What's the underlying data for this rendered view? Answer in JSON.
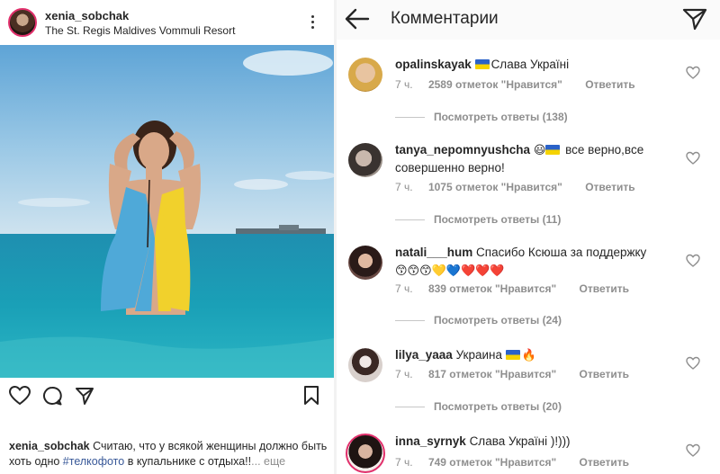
{
  "post": {
    "username": "xenia_sobchak",
    "location": "The St. Regis Maldives Vommuli Resort",
    "caption": {
      "username": "xenia_sobchak",
      "text_before": " Считаю, что у всякой женщины должно быть хоть одно ",
      "hashtag": "#телкофото",
      "text_after": " в купальнике с отдыха!!",
      "more": "... еще"
    }
  },
  "comments_panel": {
    "title": "Комментарии",
    "comments": [
      {
        "username": "opalinskayak",
        "flag": true,
        "text": "Слава Україні",
        "time": "7 ч.",
        "likes": "2589 отметок \"Нравится\"",
        "reply": "Ответить",
        "view_replies": "Посмотреть ответы (138)"
      },
      {
        "username": "tanya_nepomnyushcha",
        "text": "все верно,все совершенно верно!",
        "emojis": "😃",
        "flag": true,
        "time": "7 ч.",
        "likes": "1075 отметок \"Нравится\"",
        "reply": "Ответить",
        "view_replies": "Посмотреть ответы (11)"
      },
      {
        "username": "natali___hum",
        "text": "Спасибо Ксюша за поддержку",
        "emojis": "😙😙😙💛💙❤️❤️❤️",
        "time": "7 ч.",
        "likes": "839 отметок \"Нравится\"",
        "reply": "Ответить",
        "view_replies": "Посмотреть ответы (24)"
      },
      {
        "username": "lilya_yaaa",
        "text": "Украина",
        "emojis": "🔥",
        "flag": true,
        "time": "7 ч.",
        "likes": "817 отметок \"Нравится\"",
        "reply": "Ответить",
        "view_replies": "Посмотреть ответы (20)"
      },
      {
        "username": "inna_syrnyk",
        "text": "Слава Україні )!)))",
        "time": "7 ч.",
        "likes": "749 отметок \"Нравится\"",
        "reply": "Ответить"
      }
    ]
  },
  "colors": {
    "text": "#262626",
    "secondary": "#8e8e8e",
    "hashtag": "#385898",
    "flag_blue": "#2a62c8",
    "flag_yellow": "#f5d300"
  },
  "icons": [
    "more-icon",
    "heart-icon",
    "comment-icon",
    "share-icon",
    "bookmark-icon",
    "back-arrow-icon",
    "send-icon",
    "like-comment-icon"
  ]
}
